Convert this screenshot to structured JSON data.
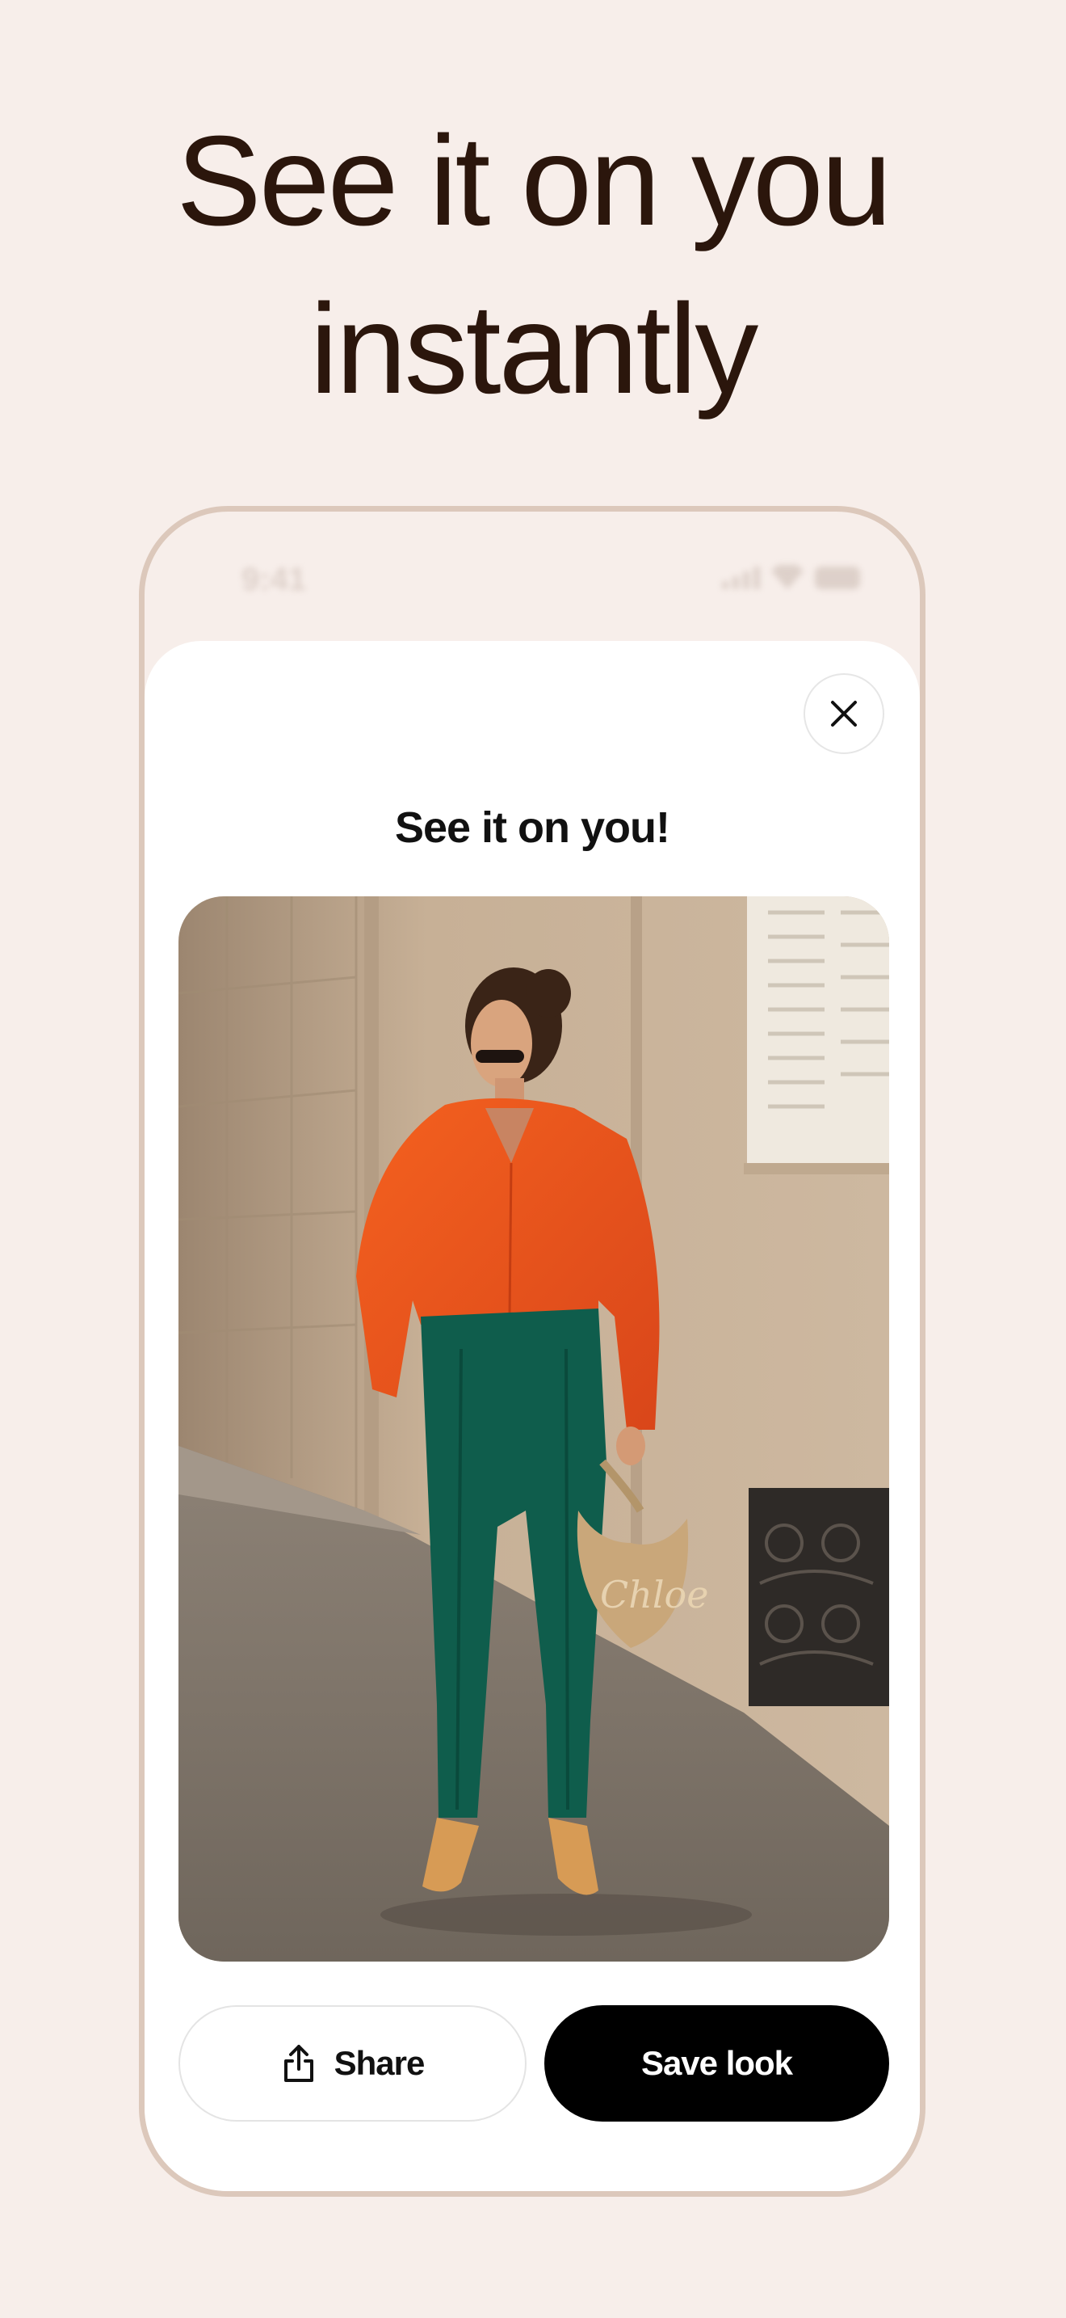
{
  "headline": {
    "line1": "See it on you",
    "line2": "instantly"
  },
  "status_bar": {
    "time": "9:41"
  },
  "sheet": {
    "title": "See it on you!",
    "close_icon": "close-icon"
  },
  "photo": {
    "bag_text": "Chloe"
  },
  "actions": {
    "share_label": "Share",
    "share_icon": "share-icon",
    "save_label": "Save look"
  },
  "colors": {
    "background": "#f7eeea",
    "headline": "#2b160c",
    "phone_border": "#dcc8bb",
    "save_button": "#000000",
    "shirt": "#f0531d",
    "trousers": "#0f5d4c"
  }
}
